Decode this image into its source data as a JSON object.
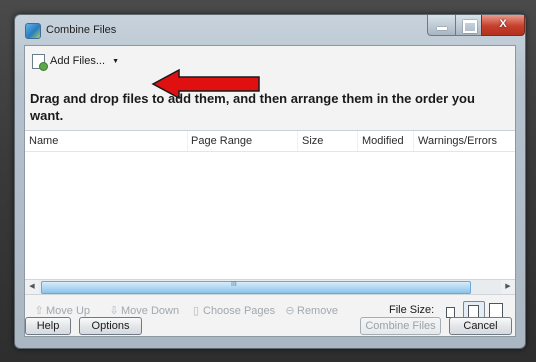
{
  "window": {
    "title": "Combine Files",
    "controls": {
      "minimize_icon": "minimize-icon",
      "maximize_icon": "maximize-icon",
      "close_label": "X"
    }
  },
  "toolbar_top": {
    "add_files_label": "Add Files...",
    "dropdown_caret": "▼"
  },
  "instructions": "Drag and drop files to add them, and then arrange them in the order you want.",
  "annotation": {
    "arrow_color": "#e01010"
  },
  "table": {
    "columns": [
      "Name",
      "Page Range",
      "Size",
      "Modified",
      "Warnings/Errors"
    ],
    "rows": []
  },
  "scrollbar": {
    "left_arrow": "◀",
    "right_arrow": "▶",
    "grip": "III"
  },
  "actions": {
    "move_up": "Move Up",
    "move_down": "Move Down",
    "choose_pages": "Choose Pages",
    "remove": "Remove",
    "file_size_label": "File Size:"
  },
  "footer": {
    "help": "Help",
    "options": "Options",
    "combine": "Combine Files",
    "cancel": "Cancel"
  }
}
